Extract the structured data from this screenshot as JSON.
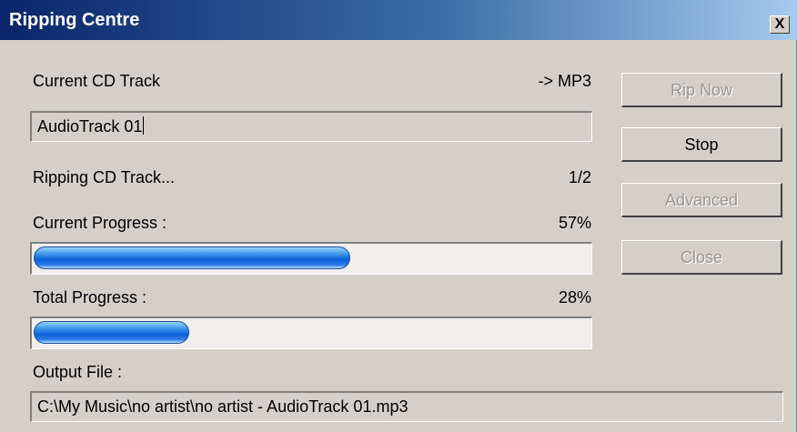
{
  "window": {
    "title": "Ripping Centre",
    "close_label": "X"
  },
  "current_track": {
    "label": "Current CD Track",
    "format": "-> MP3",
    "value": "AudioTrack 01"
  },
  "ripping": {
    "label": "Ripping CD Track...",
    "count": "1/2"
  },
  "current_progress": {
    "label": "Current Progress :",
    "percent_text": "57%",
    "value": 0.57
  },
  "total_progress": {
    "label": "Total Progress :",
    "percent_text": "28%",
    "value": 0.28
  },
  "output": {
    "label": "Output File :",
    "value": "C:\\My Music\\no artist\\no artist - AudioTrack 01.mp3"
  },
  "buttons": {
    "rip_now": {
      "label": "Rip Now",
      "enabled": false
    },
    "stop": {
      "label": "Stop",
      "enabled": true
    },
    "advanced": {
      "label": "Advanced",
      "enabled": false
    },
    "close": {
      "label": "Close",
      "enabled": false
    }
  }
}
